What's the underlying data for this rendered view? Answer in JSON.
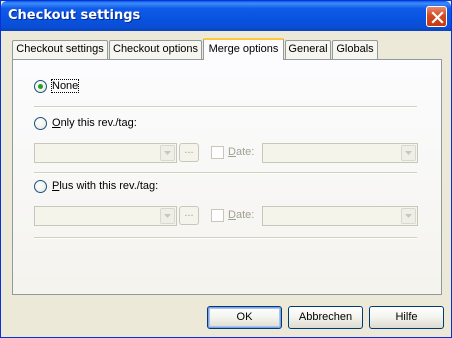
{
  "window": {
    "title": "Checkout settings"
  },
  "tabs": [
    {
      "label": "Checkout settings"
    },
    {
      "label": "Checkout options"
    },
    {
      "label": "Merge options",
      "active": true
    },
    {
      "label": "General"
    },
    {
      "label": "Globals"
    }
  ],
  "merge": {
    "none": {
      "label": "None",
      "selected": true
    },
    "only_rev": {
      "label_underlined": "O",
      "label_rest": "nly this rev./tag:",
      "selected": false
    },
    "plus_rev": {
      "label_underlined": "P",
      "label_rest": "lus with this rev./tag:",
      "selected": false
    },
    "browse_label": "...",
    "date_label_underlined": "D",
    "date_label_rest": "ate:"
  },
  "buttons": {
    "ok": "OK",
    "cancel": "Abbrechen",
    "help": "Hilfe"
  },
  "colors": {
    "titlebar": "#0853e0",
    "dialog_bg": "#ece9d8",
    "radio_dot": "#21a121",
    "active_tab_accent": "#ffc83c"
  }
}
